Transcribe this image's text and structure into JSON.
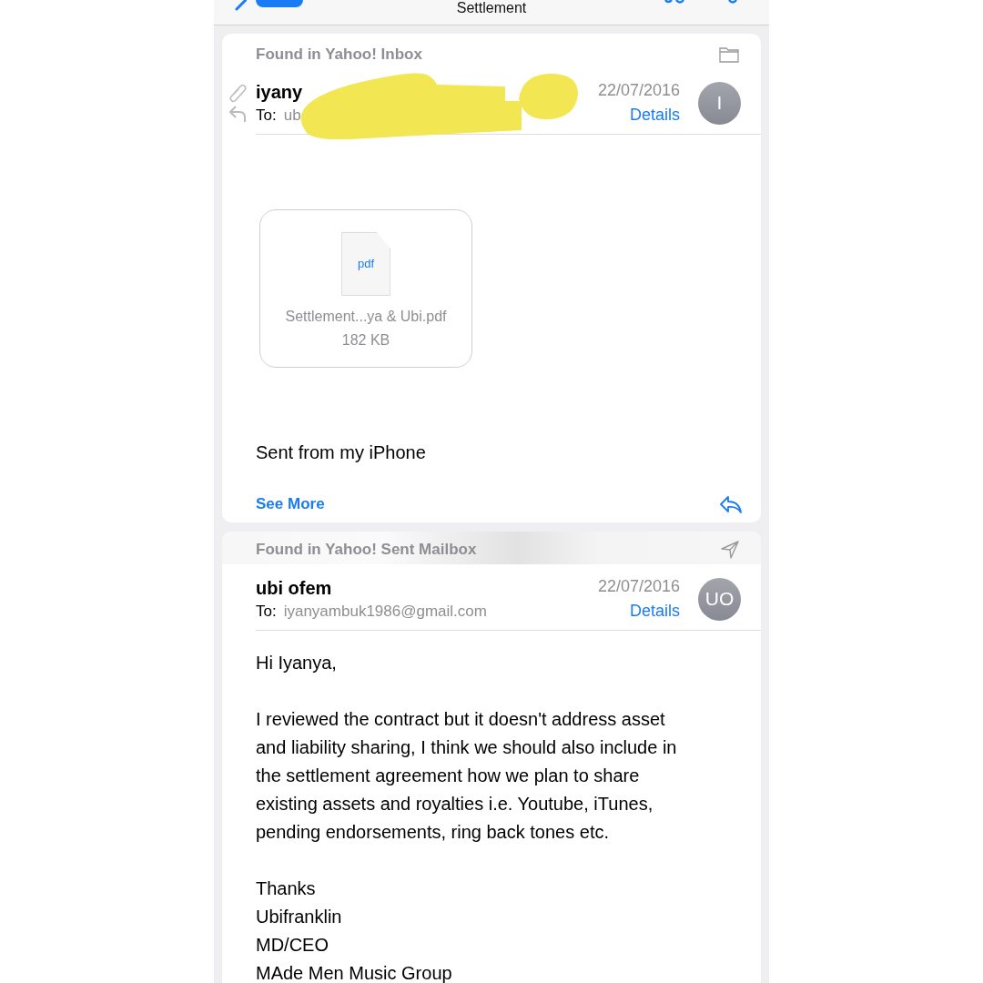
{
  "nav": {
    "title": "Settlement"
  },
  "messages": [
    {
      "source": "Found in Yahoo! Inbox",
      "kind": "folder",
      "sender": "iyany",
      "to_label": "To:",
      "to": "ub",
      "date": "22/07/2016",
      "details": "Details",
      "avatar": "I",
      "has_attachment": true,
      "replied": true,
      "redacted": true,
      "attachment": {
        "type": "pdf",
        "name": "Settlement...ya & Ubi.pdf",
        "size": "182 KB"
      },
      "body": [
        [
          "Sent from my iPhone"
        ]
      ],
      "see_more": "See More"
    },
    {
      "source": "Found in Yahoo! Sent Mailbox",
      "kind": "sent",
      "sender": "ubi ofem",
      "to_label": "To:",
      "to": "iyanyambuk1986@gmail.com",
      "date": "22/07/2016",
      "details": "Details",
      "avatar": "UO",
      "has_attachment": false,
      "replied": false,
      "redacted": false,
      "body": [
        [
          "Hi Iyanya,"
        ],
        [
          "I reviewed the contract but it doesn't address asset",
          "and liability sharing, I think we should also include in",
          "the settlement agreement how we plan to share",
          "existing assets and royalties i.e. Youtube, iTunes,",
          "pending endorsements, ring back tones etc."
        ],
        [
          "Thanks",
          "Ubifranklin",
          "MD/CEO",
          "MAde Men Music Group"
        ]
      ]
    }
  ]
}
